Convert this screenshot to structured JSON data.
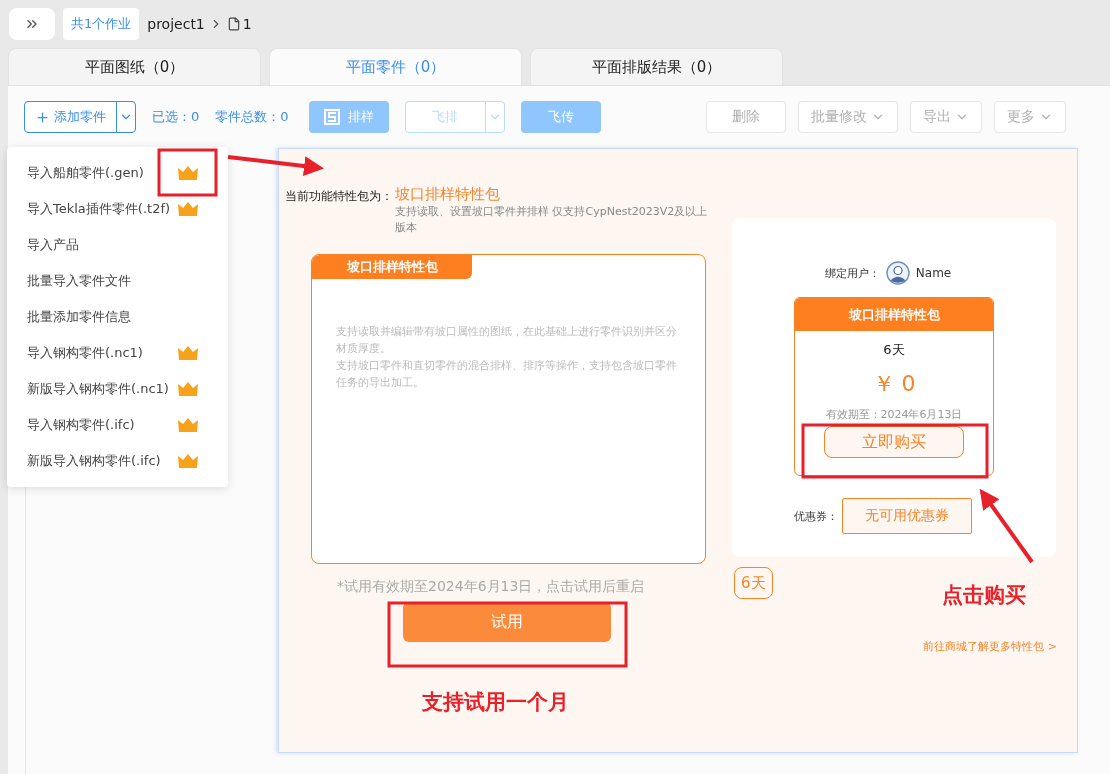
{
  "top_bar": {
    "jobs_chip": "共1个作业",
    "project": "project1",
    "file": "1"
  },
  "tabs": [
    {
      "label": "平面图纸（0）",
      "selected": false
    },
    {
      "label": "平面零件（0）",
      "selected": true
    },
    {
      "label": "平面排版结果（0）",
      "selected": false
    }
  ],
  "toolbar": {
    "add_button": "添加零件",
    "counts": [
      "已选：0",
      "零件总数：0"
    ],
    "buttons": [
      {
        "label": "排样",
        "kind": "primary",
        "disabled": true
      },
      {
        "label": "飞排",
        "kind": "split",
        "disabled": true
      },
      {
        "label": "飞传",
        "kind": "plain-primary",
        "disabled": true
      },
      {
        "label": "删除",
        "kind": "plain",
        "disabled": true
      },
      {
        "label": "批量修改",
        "kind": "dropdown",
        "disabled": true
      },
      {
        "label": "导出",
        "kind": "dropdown",
        "disabled": true
      },
      {
        "label": "更多",
        "kind": "dropdown",
        "disabled": true
      }
    ]
  },
  "add_menu": {
    "items": [
      {
        "label": "导入船舶零件(.gen)",
        "vip": true
      },
      {
        "label": "导入Tekla插件零件(.t2f)",
        "vip": true
      },
      {
        "label": "导入产品",
        "vip": false
      },
      {
        "label": "批量导入零件文件",
        "vip": false
      },
      {
        "label": "批量添加零件信息",
        "vip": false
      },
      {
        "label": "导入钢构零件(.nc1)",
        "vip": true
      },
      {
        "label": "新版导入钢构零件(.nc1)",
        "vip": true
      },
      {
        "label": "导入钢构零件(.ifc)",
        "vip": true
      },
      {
        "label": "新版导入钢构零件(.ifc)",
        "vip": true
      }
    ]
  },
  "feature_dialog": {
    "current_label": "当前功能特性包为：",
    "current_name": "坡口排样特性包",
    "current_desc": "支持读取、设置坡口零件并排样 仅支持CypNest2023V2及以上版本",
    "package_box": {
      "title": "坡口排样特性包",
      "paragraphs": [
        "支持读取并编辑带有坡口属性的图纸，在此基础上进行零件识别并区分材质厚度。",
        "支持坡口零件和直切零件的混合排样、排序等操作，支持包含坡口零件任务的导出加工。"
      ]
    },
    "trial_note": "*试用有效期至2024年6月13日，点击试用后重启",
    "trial_button": "试用",
    "bound_user_label": "绑定用户：",
    "user_name": "Name",
    "package_card": {
      "title": "坡口排样特性包",
      "duration": "6天",
      "price": "￥ 0",
      "expiry": "有效期至：2024年6月13日",
      "buy_button": "立即购买"
    },
    "coupon_label": "优惠券：",
    "coupon_button": "无可用优惠券",
    "duration_tag": "6天",
    "store_link": "前往商城了解更多特性包 >"
  },
  "annotations": {
    "buy_hint": "点击购买",
    "trial_hint": "支持试用一个月"
  }
}
